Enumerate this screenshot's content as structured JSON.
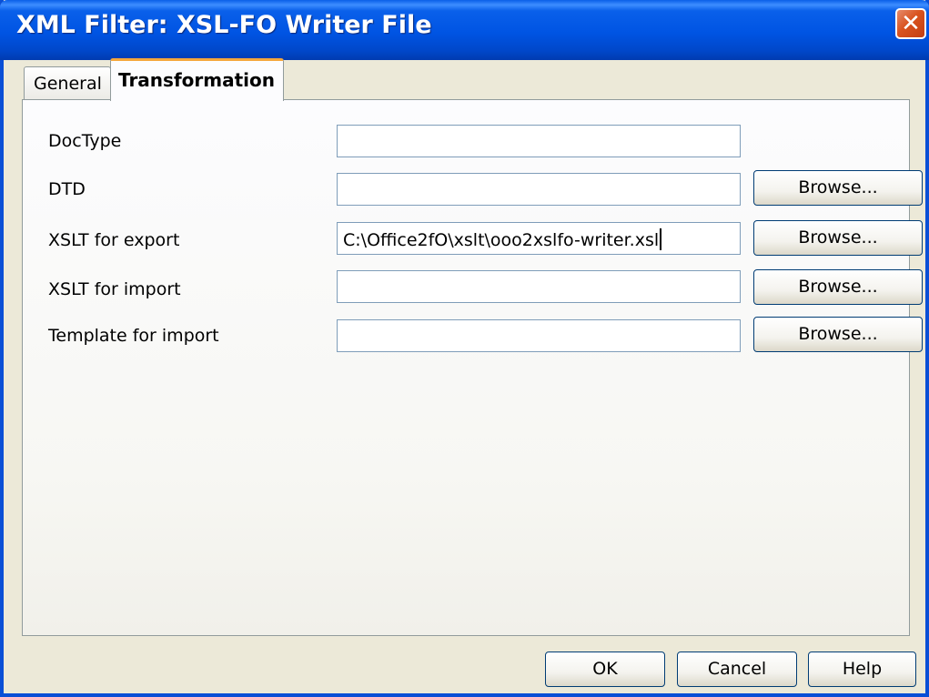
{
  "window": {
    "title": "XML Filter: XSL-FO Writer File",
    "close_glyph": "✕",
    "close_icon": "close-icon"
  },
  "tabs": [
    {
      "label": "General",
      "selected": false
    },
    {
      "label": "Transformation",
      "selected": true
    }
  ],
  "form": {
    "doctype": {
      "label": "DocType",
      "value": ""
    },
    "dtd": {
      "label": "DTD",
      "value": "",
      "browse_label": "Browse..."
    },
    "xslt_export": {
      "label": "XSLT for export",
      "value": "C:\\Office2fO\\xslt\\ooo2xslfo-writer.xsl",
      "browse_label": "Browse..."
    },
    "xslt_import": {
      "label": "XSLT for import",
      "value": "",
      "browse_label": "Browse..."
    },
    "template_import": {
      "label": "Template for import",
      "value": "",
      "browse_label": "Browse..."
    }
  },
  "buttons": {
    "ok": "OK",
    "cancel": "Cancel",
    "help": "Help"
  },
  "colors": {
    "titlebar": "#0054e3",
    "dialog_bg": "#ece9d8",
    "tab_highlight": "#f5a73c",
    "close_button": "#d9531f"
  }
}
